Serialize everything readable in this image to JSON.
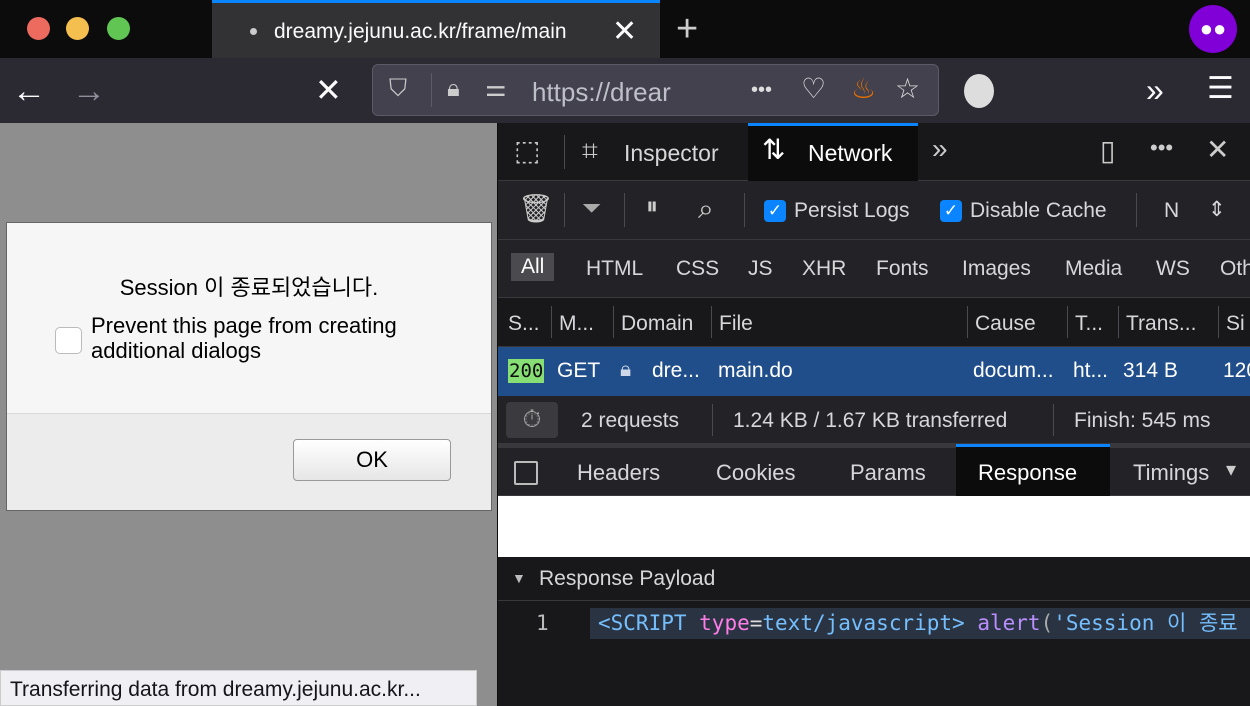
{
  "window": {
    "controls": [
      "close",
      "minimize",
      "zoom"
    ],
    "colors": {
      "close": "#ed6a5e",
      "minimize": "#f5bf4f",
      "zoom": "#61c554"
    }
  },
  "tab": {
    "title": "dreamy.jejunu.ac.kr/frame/main",
    "new_tab": "+"
  },
  "toolbar": {
    "url": "https://drear",
    "more": "•••"
  },
  "dialog": {
    "message": "Session 이 종료되었습니다.",
    "checkbox_label": "Prevent this page from creating additional dialogs",
    "checked": false,
    "ok": "OK"
  },
  "status": "Transferring data from dreamy.jejunu.ac.kr...",
  "devtools": {
    "tabs": [
      {
        "label": "Inspector"
      },
      {
        "label": "Network",
        "active": true
      }
    ],
    "persist_logs": "Persist Logs",
    "disable_cache": "Disable Cache",
    "throttle": "N",
    "filters": [
      "All",
      "HTML",
      "CSS",
      "JS",
      "XHR",
      "Fonts",
      "Images",
      "Media",
      "WS",
      "Oth"
    ],
    "columns": [
      "S...",
      "M...",
      "Domain",
      "File",
      "Cause",
      "T...",
      "Trans...",
      "Si"
    ],
    "rows": [
      {
        "status": "200",
        "method": "GET",
        "domain": "dre...",
        "file": "main.do",
        "cause": "docum...",
        "type": "ht...",
        "transferred": "314 B",
        "size": "120"
      }
    ],
    "summary": {
      "requests": "2 requests",
      "transferred": "1.24 KB / 1.67 KB transferred",
      "finish": "Finish: 545 ms"
    },
    "detail_tabs": [
      "Headers",
      "Cookies",
      "Params",
      "Response",
      "Timings"
    ],
    "active_detail": "Response",
    "payload_title": "Response Payload",
    "code": {
      "line": "1",
      "tag_open": "<SCRIPT ",
      "attr": "type",
      "eq": "=",
      "value": "text/javascript>",
      "space": " ",
      "fn": "alert",
      "paren": "(",
      "str": "'Session 이 종료"
    }
  }
}
